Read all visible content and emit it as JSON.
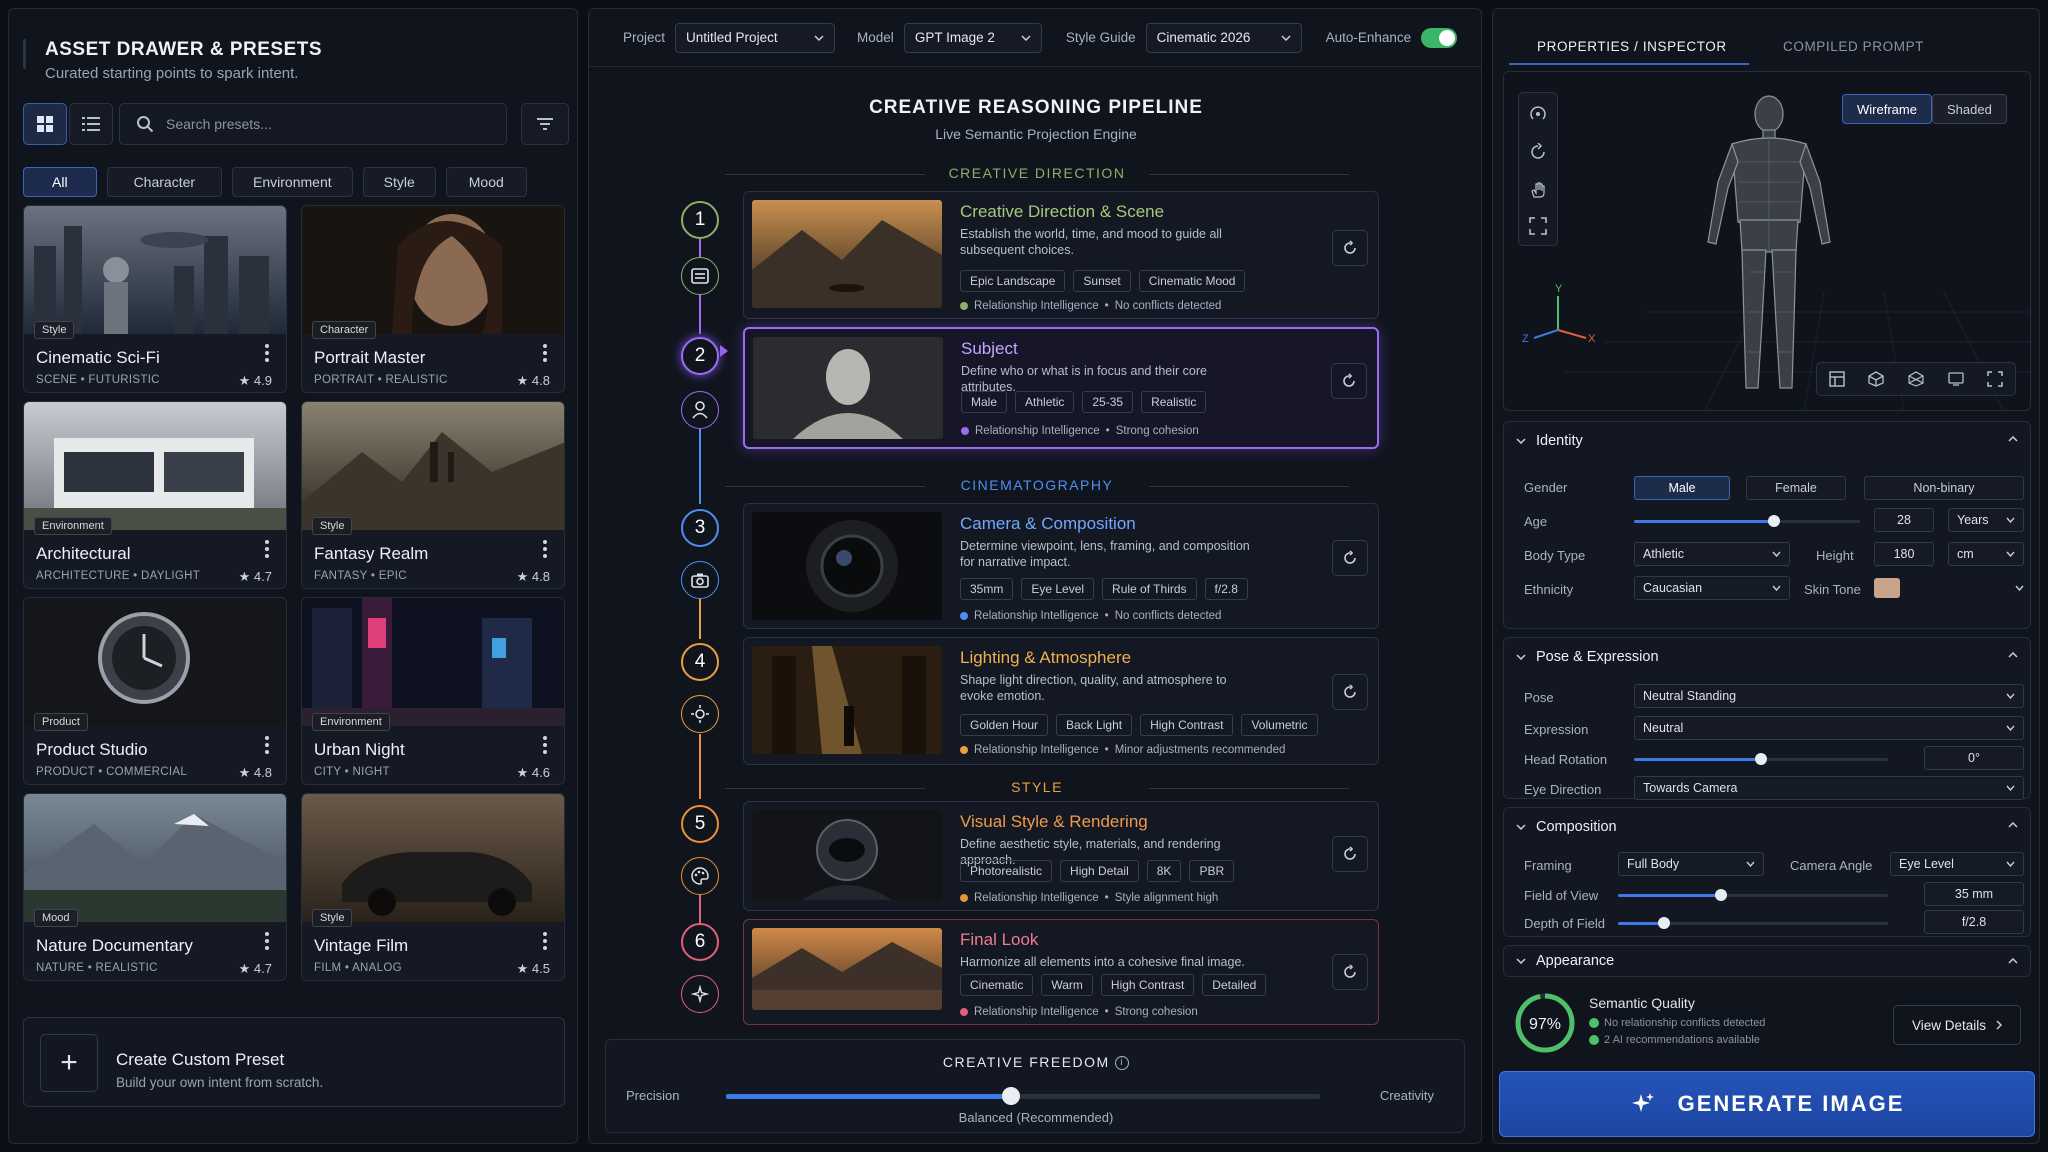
{
  "left": {
    "title": "ASSET DRAWER & PRESETS",
    "subtitle": "Curated starting points to spark intent.",
    "search_placeholder": "Search presets...",
    "chips": [
      "All",
      "Character",
      "Environment",
      "Style",
      "Mood"
    ],
    "cards": [
      {
        "name": "Cinematic Sci-Fi",
        "tag": "Style",
        "meta": "SCENE • FUTURISTIC",
        "rating": "★ 4.9"
      },
      {
        "name": "Portrait Master",
        "tag": "Character",
        "meta": "PORTRAIT • REALISTIC",
        "rating": "★ 4.8"
      },
      {
        "name": "Architectural",
        "tag": "Environment",
        "meta": "ARCHITECTURE • DAYLIGHT",
        "rating": "★ 4.7"
      },
      {
        "name": "Fantasy Realm",
        "tag": "Style",
        "meta": "FANTASY • EPIC",
        "rating": "★ 4.8"
      },
      {
        "name": "Product Studio",
        "tag": "Product",
        "meta": "PRODUCT • COMMERCIAL",
        "rating": "★ 4.8"
      },
      {
        "name": "Urban Night",
        "tag": "Environment",
        "meta": "CITY • NIGHT",
        "rating": "★ 4.6"
      },
      {
        "name": "Nature Documentary",
        "tag": "Mood",
        "meta": "NATURE • REALISTIC",
        "rating": "★ 4.7"
      },
      {
        "name": "Vintage Film",
        "tag": "Style",
        "meta": "FILM • ANALOG",
        "rating": "★ 4.5"
      }
    ],
    "create_title": "Create Custom Preset",
    "create_sub": "Build your own intent from scratch."
  },
  "center": {
    "project_label": "Project",
    "project_value": "Untitled Project",
    "model_label": "Model",
    "model_value": "GPT Image 2",
    "style_label": "Style Guide",
    "style_value": "Cinematic 2026",
    "auto_label": "Auto-Enhance",
    "auto_on": true,
    "title": "CREATIVE REASONING PIPELINE",
    "subtitle": "Live Semantic Projection Engine",
    "sections": [
      "CREATIVE DIRECTION",
      "CINEMATOGRAPHY",
      "STYLE"
    ],
    "steps": [
      {
        "num": "1",
        "title": "Creative Direction & Scene",
        "desc": "Establish the world, time, and mood to guide all subsequent choices.",
        "tags": [
          "Epic Landscape",
          "Sunset",
          "Cinematic Mood"
        ],
        "ri_label": "Relationship Intelligence",
        "ri_status": "No conflicts detected"
      },
      {
        "num": "2",
        "title": "Subject",
        "desc": "Define who or what is in focus and their core attributes.",
        "tags": [
          "Male",
          "Athletic",
          "25-35",
          "Realistic"
        ],
        "ri_label": "Relationship Intelligence",
        "ri_status": "Strong cohesion"
      },
      {
        "num": "3",
        "title": "Camera & Composition",
        "desc": "Determine viewpoint, lens, framing, and composition for narrative impact.",
        "tags": [
          "35mm",
          "Eye Level",
          "Rule of Thirds",
          "f/2.8"
        ],
        "ri_label": "Relationship Intelligence",
        "ri_status": "No conflicts detected"
      },
      {
        "num": "4",
        "title": "Lighting & Atmosphere",
        "desc": "Shape light direction, quality, and atmosphere to evoke emotion.",
        "tags": [
          "Golden Hour",
          "Back Light",
          "High Contrast",
          "Volumetric"
        ],
        "ri_label": "Relationship Intelligence",
        "ri_status": "Minor adjustments recommended"
      },
      {
        "num": "5",
        "title": "Visual Style & Rendering",
        "desc": "Define aesthetic style, materials, and rendering approach.",
        "tags": [
          "Photorealistic",
          "High Detail",
          "8K",
          "PBR"
        ],
        "ri_label": "Relationship Intelligence",
        "ri_status": "Style alignment high"
      },
      {
        "num": "6",
        "title": "Final Look",
        "desc": "Harmonize all elements into a cohesive final image.",
        "tags": [
          "Cinematic",
          "Warm",
          "High Contrast",
          "Detailed"
        ],
        "ri_label": "Relationship Intelligence",
        "ri_status": "Strong cohesion"
      }
    ],
    "colors": [
      "#8fae6a",
      "#9b6cf0",
      "#4f8ff0",
      "#e8a040",
      "#e8903a",
      "#e0607a"
    ],
    "freedom_title": "CREATIVE FREEDOM",
    "freedom_left": "Precision",
    "freedom_right": "Creativity",
    "freedom_value_label": "Balanced (Recommended)",
    "freedom_level": 0.48
  },
  "right": {
    "tab_active": "PROPERTIES / INSPECTOR",
    "tab_other": "COMPILED PROMPT",
    "mode_on": "Wireframe",
    "mode_off": "Shaded",
    "axis_labels": [
      "Y",
      "Z",
      "X"
    ],
    "identity": {
      "title": "Identity",
      "gender_label": "Gender",
      "gender_options": [
        "Male",
        "Female",
        "Non-binary"
      ],
      "age_label": "Age",
      "age_value": "28",
      "age_unit": "Years",
      "age_level": 0.62,
      "body_label": "Body Type",
      "body_value": "Athletic",
      "height_label": "Height",
      "height_value": "180",
      "height_unit": "cm",
      "ethnicity_label": "Ethnicity",
      "ethnicity_value": "Caucasian",
      "skin_label": "Skin Tone",
      "skin_color": "#c9a38a"
    },
    "pose": {
      "title": "Pose & Expression",
      "pose_label": "Pose",
      "pose_value": "Neutral Standing",
      "expr_label": "Expression",
      "expr_value": "Neutral",
      "head_label": "Head Rotation",
      "head_value": "0°",
      "head_level": 0.5,
      "eye_label": "Eye Direction",
      "eye_value": "Towards Camera"
    },
    "composition": {
      "title": "Composition",
      "framing_label": "Framing",
      "framing_value": "Full Body",
      "angle_label": "Camera Angle",
      "angle_value": "Eye Level",
      "fov_label": "Field of View",
      "fov_value": "35 mm",
      "fov_level": 0.38,
      "dof_label": "Depth of Field",
      "dof_value": "f/2.8",
      "dof_level": 0.17
    },
    "appearance_title": "Appearance",
    "quality": {
      "percent": "97%",
      "level": 0.97,
      "title": "Semantic Quality",
      "line1": "No relationship conflicts detected",
      "line2": "2 AI recommendations available",
      "button": "View Details"
    },
    "generate": "GENERATE IMAGE"
  }
}
